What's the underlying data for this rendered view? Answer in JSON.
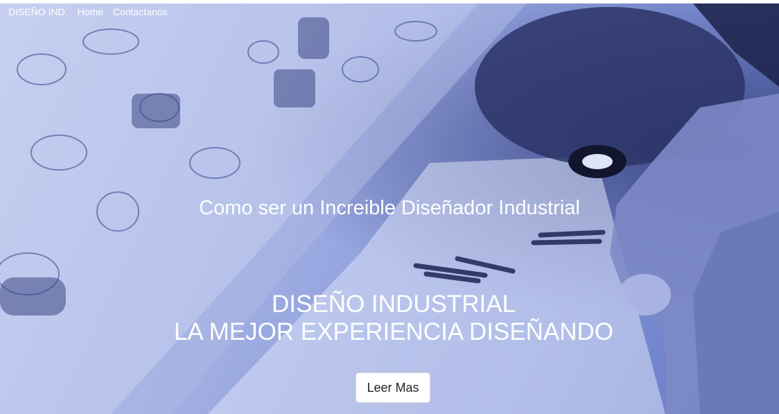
{
  "nav": {
    "brand": "DISEÑO IND.",
    "links": [
      "Home",
      "Contactanos"
    ]
  },
  "hero": {
    "subtitle": "Como ser un Increible Diseñador Industrial",
    "title_line1": "DISEÑO INDUSTRIAL",
    "title_line2": "LA MEJOR EXPERIENCIA DISEÑANDO",
    "button_label": "Leer Mas"
  },
  "colors": {
    "overlay_light": "#c3ccef",
    "overlay_mid": "#8e9fdc",
    "overlay_dark": "#5f72bf",
    "text": "#ffffff",
    "button_bg": "#ffffff",
    "button_text": "#222222"
  }
}
